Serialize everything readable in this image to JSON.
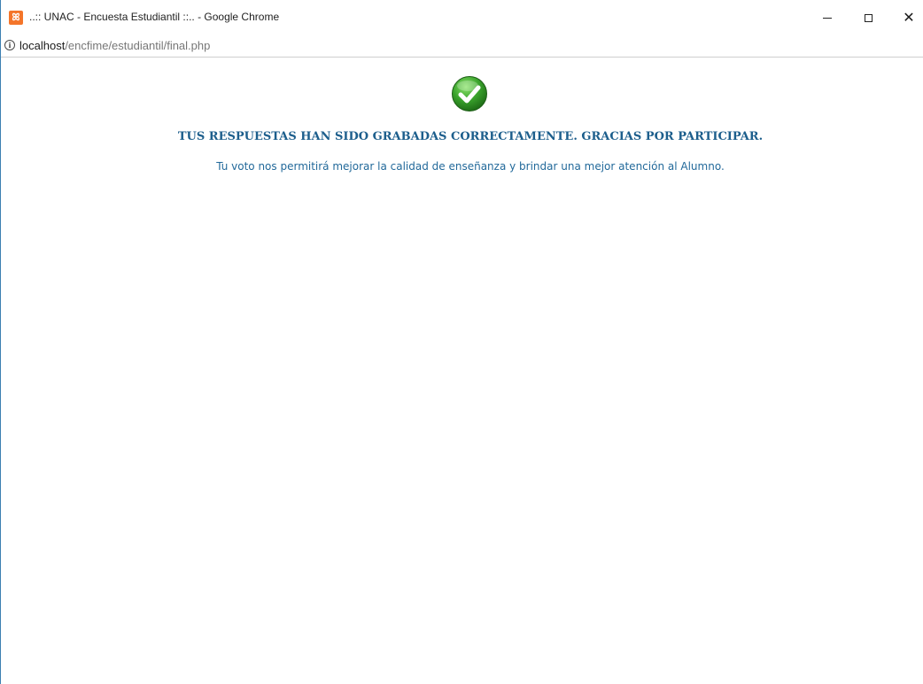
{
  "window": {
    "title": "..:: UNAC - Encuesta Estudiantil ::.. - Google Chrome",
    "favicon_label": "ꕤ",
    "minimize_glyph": "",
    "close_glyph": "✕"
  },
  "address": {
    "host": "localhost",
    "path": "/encfime/estudiantil/final.php",
    "info_glyph": "i"
  },
  "page": {
    "success_icon": "check-circle-icon",
    "headline": "TUS RESPUESTAS HAN SIDO GRABADAS CORRECTAMENTE. GRACIAS POR PARTICIPAR.",
    "message": "Tu voto nos permitirá mejorar la calidad de enseñanza y brindar una mejor atención al Alumno."
  },
  "colors": {
    "headline": "#1c5e8c",
    "message": "#22699a",
    "success_green": "#3aa32c",
    "favicon": "#f4752a"
  }
}
